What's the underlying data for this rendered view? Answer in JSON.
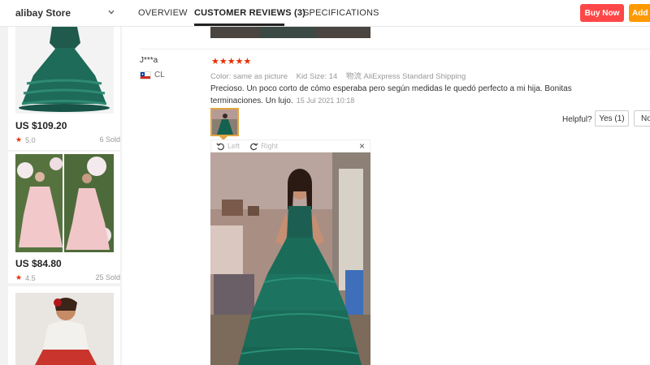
{
  "sidebar": {
    "store_name": "alibay Store",
    "products": [
      {
        "price": "US $109.20",
        "rating": "5.0",
        "sold": "6 Sold"
      },
      {
        "price": "US $84.80",
        "rating": "4.5",
        "sold": "25 Sold"
      },
      {
        "price": "",
        "rating": "",
        "sold": ""
      }
    ]
  },
  "tabs": {
    "items": [
      {
        "label": "OVERVIEW"
      },
      {
        "label": "CUSTOMER REVIEWS (3)"
      },
      {
        "label": "SPECIFICATIONS"
      }
    ],
    "active_index": 1
  },
  "actions": {
    "buy_now": "Buy Now",
    "add": "Add"
  },
  "review": {
    "reviewer": "J***a",
    "country": "CL",
    "stars": "★★★★★",
    "color_label": "Color:",
    "color_value": "same as picture",
    "size_label": "Kid Size:",
    "size_value": "14",
    "shipping_label": "物流",
    "shipping_value": "AliExpress Standard Shipping",
    "text": "Precioso. Un poco corto de cómo esperaba pero según medidas le quedó perfecto a mi hija. Bonitas terminaciones. Un lujo.",
    "date": "15 Jul 2021 10:18",
    "helpful_label": "Helpful?",
    "yes_label": "Yes (1)",
    "no_label": "No"
  },
  "viewer": {
    "left_label": "Left",
    "right_label": "Right",
    "close": "×"
  },
  "colors": {
    "buy_now": "#ff4747",
    "add_to_cart": "#ff9900",
    "star": "#e62e04",
    "thumb_border": "#e2a540"
  }
}
